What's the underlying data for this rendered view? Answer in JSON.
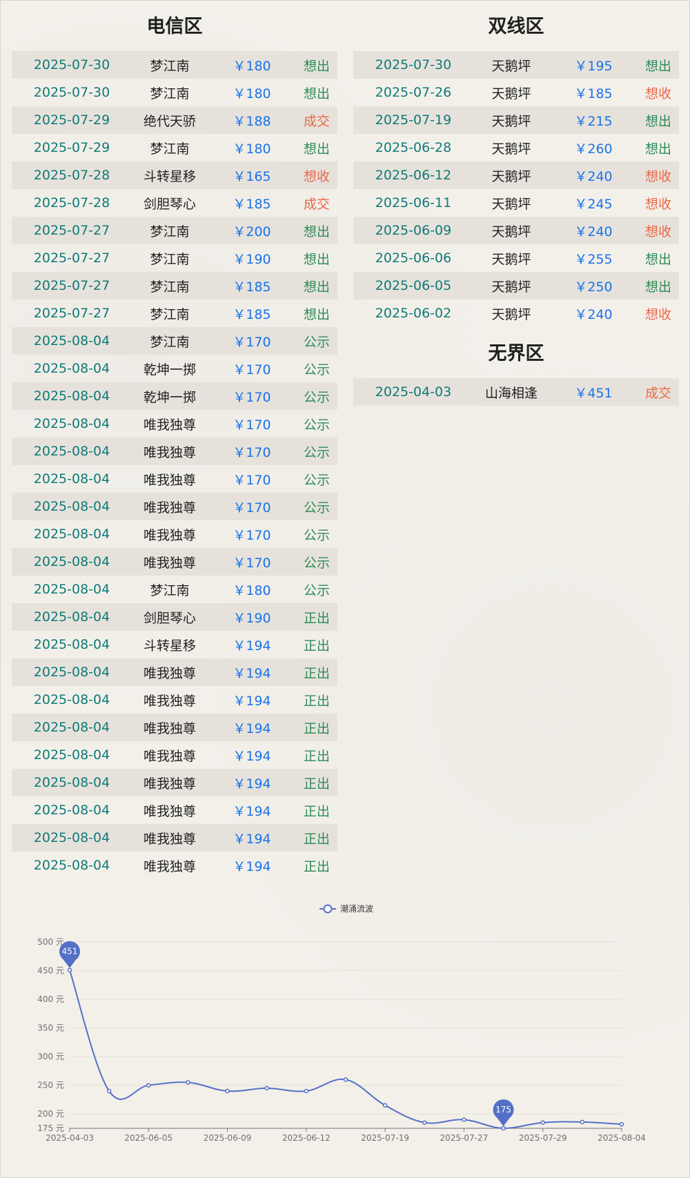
{
  "telecom": {
    "title": "电信区",
    "rows": [
      {
        "date": "2025-07-30",
        "name": "梦江南",
        "price": "￥180",
        "status": "想出",
        "tone": "green"
      },
      {
        "date": "2025-07-30",
        "name": "梦江南",
        "price": "￥180",
        "status": "想出",
        "tone": "green"
      },
      {
        "date": "2025-07-29",
        "name": "绝代天骄",
        "price": "￥188",
        "status": "成交",
        "tone": "red"
      },
      {
        "date": "2025-07-29",
        "name": "梦江南",
        "price": "￥180",
        "status": "想出",
        "tone": "green"
      },
      {
        "date": "2025-07-28",
        "name": "斗转星移",
        "price": "￥165",
        "status": "想收",
        "tone": "red"
      },
      {
        "date": "2025-07-28",
        "name": "剑胆琴心",
        "price": "￥185",
        "status": "成交",
        "tone": "red"
      },
      {
        "date": "2025-07-27",
        "name": "梦江南",
        "price": "￥200",
        "status": "想出",
        "tone": "green"
      },
      {
        "date": "2025-07-27",
        "name": "梦江南",
        "price": "￥190",
        "status": "想出",
        "tone": "green"
      },
      {
        "date": "2025-07-27",
        "name": "梦江南",
        "price": "￥185",
        "status": "想出",
        "tone": "green"
      },
      {
        "date": "2025-07-27",
        "name": "梦江南",
        "price": "￥185",
        "status": "想出",
        "tone": "green"
      },
      {
        "date": "2025-08-04",
        "name": "梦江南",
        "price": "￥170",
        "status": "公示",
        "tone": "green"
      },
      {
        "date": "2025-08-04",
        "name": "乾坤一掷",
        "price": "￥170",
        "status": "公示",
        "tone": "green"
      },
      {
        "date": "2025-08-04",
        "name": "乾坤一掷",
        "price": "￥170",
        "status": "公示",
        "tone": "green"
      },
      {
        "date": "2025-08-04",
        "name": "唯我独尊",
        "price": "￥170",
        "status": "公示",
        "tone": "green"
      },
      {
        "date": "2025-08-04",
        "name": "唯我独尊",
        "price": "￥170",
        "status": "公示",
        "tone": "green"
      },
      {
        "date": "2025-08-04",
        "name": "唯我独尊",
        "price": "￥170",
        "status": "公示",
        "tone": "green"
      },
      {
        "date": "2025-08-04",
        "name": "唯我独尊",
        "price": "￥170",
        "status": "公示",
        "tone": "green"
      },
      {
        "date": "2025-08-04",
        "name": "唯我独尊",
        "price": "￥170",
        "status": "公示",
        "tone": "green"
      },
      {
        "date": "2025-08-04",
        "name": "唯我独尊",
        "price": "￥170",
        "status": "公示",
        "tone": "green"
      },
      {
        "date": "2025-08-04",
        "name": "梦江南",
        "price": "￥180",
        "status": "公示",
        "tone": "green"
      },
      {
        "date": "2025-08-04",
        "name": "剑胆琴心",
        "price": "￥190",
        "status": "正出",
        "tone": "green"
      },
      {
        "date": "2025-08-04",
        "name": "斗转星移",
        "price": "￥194",
        "status": "正出",
        "tone": "green"
      },
      {
        "date": "2025-08-04",
        "name": "唯我独尊",
        "price": "￥194",
        "status": "正出",
        "tone": "green"
      },
      {
        "date": "2025-08-04",
        "name": "唯我独尊",
        "price": "￥194",
        "status": "正出",
        "tone": "green"
      },
      {
        "date": "2025-08-04",
        "name": "唯我独尊",
        "price": "￥194",
        "status": "正出",
        "tone": "green"
      },
      {
        "date": "2025-08-04",
        "name": "唯我独尊",
        "price": "￥194",
        "status": "正出",
        "tone": "green"
      },
      {
        "date": "2025-08-04",
        "name": "唯我独尊",
        "price": "￥194",
        "status": "正出",
        "tone": "green"
      },
      {
        "date": "2025-08-04",
        "name": "唯我独尊",
        "price": "￥194",
        "status": "正出",
        "tone": "green"
      },
      {
        "date": "2025-08-04",
        "name": "唯我独尊",
        "price": "￥194",
        "status": "正出",
        "tone": "green"
      },
      {
        "date": "2025-08-04",
        "name": "唯我独尊",
        "price": "￥194",
        "status": "正出",
        "tone": "green"
      }
    ]
  },
  "dual": {
    "title": "双线区",
    "rows": [
      {
        "date": "2025-07-30",
        "name": "天鹅坪",
        "price": "￥195",
        "status": "想出",
        "tone": "green"
      },
      {
        "date": "2025-07-26",
        "name": "天鹅坪",
        "price": "￥185",
        "status": "想收",
        "tone": "red"
      },
      {
        "date": "2025-07-19",
        "name": "天鹅坪",
        "price": "￥215",
        "status": "想出",
        "tone": "green"
      },
      {
        "date": "2025-06-28",
        "name": "天鹅坪",
        "price": "￥260",
        "status": "想出",
        "tone": "green"
      },
      {
        "date": "2025-06-12",
        "name": "天鹅坪",
        "price": "￥240",
        "status": "想收",
        "tone": "red"
      },
      {
        "date": "2025-06-11",
        "name": "天鹅坪",
        "price": "￥245",
        "status": "想收",
        "tone": "red"
      },
      {
        "date": "2025-06-09",
        "name": "天鹅坪",
        "price": "￥240",
        "status": "想收",
        "tone": "red"
      },
      {
        "date": "2025-06-06",
        "name": "天鹅坪",
        "price": "￥255",
        "status": "想出",
        "tone": "green"
      },
      {
        "date": "2025-06-05",
        "name": "天鹅坪",
        "price": "￥250",
        "status": "想出",
        "tone": "green"
      },
      {
        "date": "2025-06-02",
        "name": "天鹅坪",
        "price": "￥240",
        "status": "想收",
        "tone": "red"
      }
    ]
  },
  "boundless": {
    "title": "无界区",
    "rows": [
      {
        "date": "2025-04-03",
        "name": "山海相逢",
        "price": "￥451",
        "status": "成交",
        "tone": "red"
      }
    ]
  },
  "colors": {
    "line": "#5470c6",
    "date": "#0f7a78",
    "price": "#1a73e8",
    "green": "#2e8b57",
    "red": "#e8684a"
  },
  "chart_data": {
    "type": "line",
    "series": [
      {
        "name": "潮涌流波",
        "values": [
          451,
          240,
          250,
          255,
          240,
          245,
          240,
          260,
          215,
          185,
          190,
          175,
          185,
          186,
          182
        ]
      }
    ],
    "x_tick_labels": [
      "2025-04-03",
      "2025-06-05",
      "2025-06-09",
      "2025-06-12",
      "2025-07-19",
      "2025-07-27",
      "2025-07-29",
      "2025-08-04"
    ],
    "y_ticks": [
      175,
      200,
      250,
      300,
      350,
      400,
      450,
      500
    ],
    "y_tick_labels": [
      "175 元",
      "200 元",
      "250 元",
      "300 元",
      "350 元",
      "400 元",
      "450 元",
      "500 元"
    ],
    "ylim": [
      175,
      500
    ],
    "markers": [
      {
        "index": 0,
        "label": "451"
      },
      {
        "index": 11,
        "label": "175"
      }
    ],
    "legend": "top-center",
    "smooth": true
  }
}
